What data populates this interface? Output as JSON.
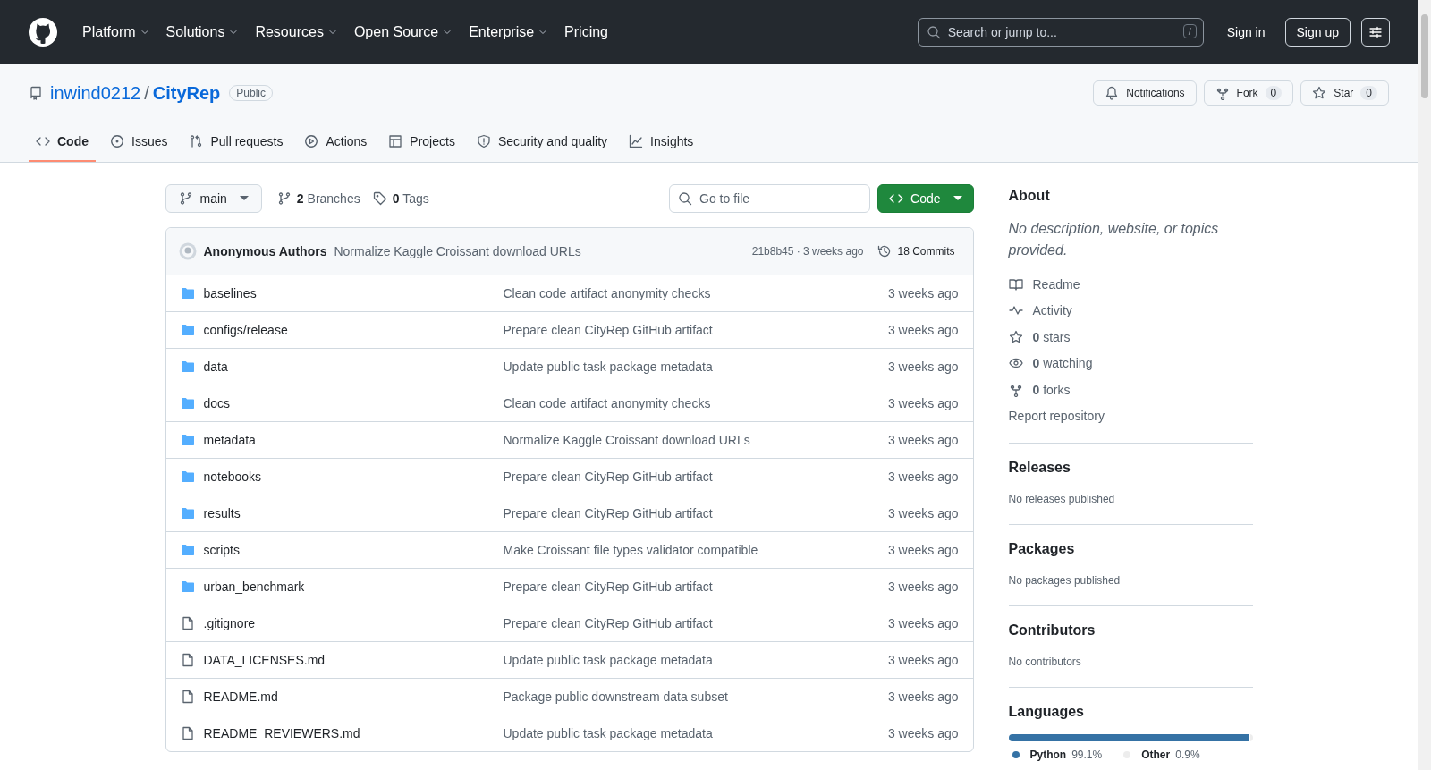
{
  "header": {
    "nav": [
      {
        "label": "Platform",
        "dropdown": true
      },
      {
        "label": "Solutions",
        "dropdown": true
      },
      {
        "label": "Resources",
        "dropdown": true
      },
      {
        "label": "Open Source",
        "dropdown": true
      },
      {
        "label": "Enterprise",
        "dropdown": true
      },
      {
        "label": "Pricing",
        "dropdown": false
      }
    ],
    "search": {
      "placeholder": "Search or jump to...",
      "shortcut": "/"
    },
    "sign_in": "Sign in",
    "sign_up": "Sign up"
  },
  "repo": {
    "owner": "inwind0212",
    "separator": "/",
    "name": "CityRep",
    "visibility": "Public",
    "actions": [
      {
        "kind": "notifications",
        "label": "Notifications"
      },
      {
        "kind": "fork",
        "label": "Fork",
        "count": "0"
      },
      {
        "kind": "star",
        "label": "Star",
        "count": "0"
      }
    ]
  },
  "tabs": [
    {
      "kind": "code",
      "label": "Code",
      "selected": true
    },
    {
      "kind": "issues",
      "label": "Issues",
      "selected": false
    },
    {
      "kind": "pulls",
      "label": "Pull requests",
      "selected": false
    },
    {
      "kind": "actions",
      "label": "Actions",
      "selected": false
    },
    {
      "kind": "projects",
      "label": "Projects",
      "selected": false
    },
    {
      "kind": "security",
      "label": "Security and quality",
      "selected": false
    },
    {
      "kind": "insights",
      "label": "Insights",
      "selected": false
    }
  ],
  "toolbar": {
    "branch": "main",
    "branches": "**2** Branches",
    "tags": "**0** Tags",
    "file_search": {
      "placeholder": "Go to file"
    },
    "code_button": "Code"
  },
  "commit": {
    "author": "Anonymous Authors",
    "message": "Normalize Kaggle Croissant download URLs",
    "hash_time": "21b8b45 · 3 weeks ago",
    "commits": "18 Commits"
  },
  "files": [
    {
      "kind": "folder",
      "name": "baselines",
      "message": "Clean code artifact anonymity checks",
      "time": "3 weeks ago"
    },
    {
      "kind": "folder",
      "name": "configs/release",
      "message": "Prepare clean CityRep GitHub artifact",
      "time": "3 weeks ago"
    },
    {
      "kind": "folder",
      "name": "data",
      "message": "Update public task package metadata",
      "time": "3 weeks ago"
    },
    {
      "kind": "folder",
      "name": "docs",
      "message": "Clean code artifact anonymity checks",
      "time": "3 weeks ago"
    },
    {
      "kind": "folder",
      "name": "metadata",
      "message": "Normalize Kaggle Croissant download URLs",
      "time": "3 weeks ago"
    },
    {
      "kind": "folder",
      "name": "notebooks",
      "message": "Prepare clean CityRep GitHub artifact",
      "time": "3 weeks ago"
    },
    {
      "kind": "folder",
      "name": "results",
      "message": "Prepare clean CityRep GitHub artifact",
      "time": "3 weeks ago"
    },
    {
      "kind": "folder",
      "name": "scripts",
      "message": "Make Croissant file types validator compatible",
      "time": "3 weeks ago"
    },
    {
      "kind": "folder",
      "name": "urban_benchmark",
      "message": "Prepare clean CityRep GitHub artifact",
      "time": "3 weeks ago"
    },
    {
      "kind": "file",
      "name": ".gitignore",
      "message": "Prepare clean CityRep GitHub artifact",
      "time": "3 weeks ago"
    },
    {
      "kind": "file",
      "name": "DATA_LICENSES.md",
      "message": "Update public task package metadata",
      "time": "3 weeks ago"
    },
    {
      "kind": "file",
      "name": "README.md",
      "message": "Package public downstream data subset",
      "time": "3 weeks ago"
    },
    {
      "kind": "file",
      "name": "README_REVIEWERS.md",
      "message": "Update public task package metadata",
      "time": "3 weeks ago"
    }
  ],
  "sidebar": {
    "about": {
      "title": "About",
      "description": "No description, website, or topics provided.",
      "links": [
        {
          "kind": "readme",
          "text": "Readme"
        },
        {
          "kind": "activity",
          "text": "Activity"
        },
        {
          "kind": "stars",
          "text": "**0** stars"
        },
        {
          "kind": "watching",
          "text": "**0** watching"
        },
        {
          "kind": "forks",
          "text": "**0** forks"
        },
        {
          "kind": "report",
          "text": "Report repository"
        }
      ]
    },
    "sections": [
      {
        "title": "Releases",
        "note": "No releases published"
      },
      {
        "title": "Packages",
        "note": "No packages published"
      },
      {
        "title": "Contributors",
        "note": "No contributors"
      }
    ],
    "languages": {
      "title": "Languages",
      "items": [
        {
          "name": "Python",
          "percent": "99.1%",
          "color": "#3572a5",
          "level": 0.991
        },
        {
          "name": "Other",
          "percent": "0.9%",
          "color": "#ededed",
          "level": 0.009
        }
      ]
    }
  }
}
